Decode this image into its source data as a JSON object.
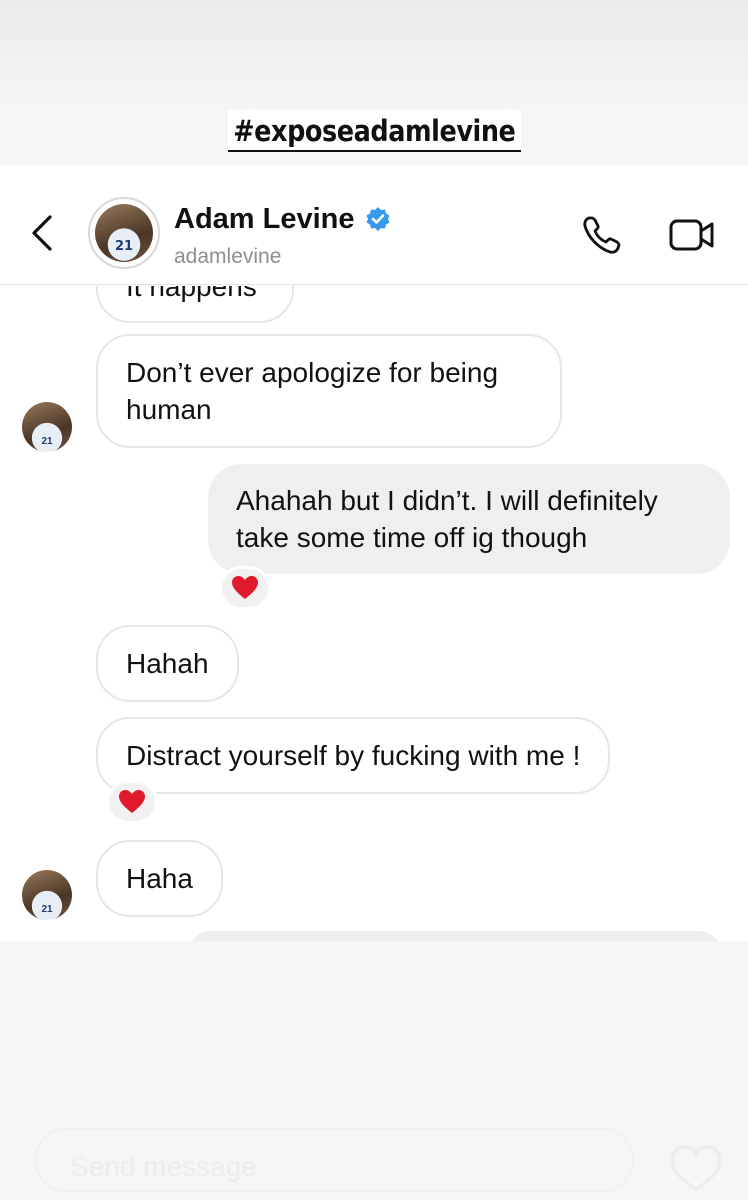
{
  "story": {
    "caption": "#exposeadamlevine",
    "composer_placeholder": "Send message"
  },
  "header": {
    "name": "Adam Levine",
    "handle": "adamlevine",
    "verified": true,
    "icons": [
      "back-chevron-icon",
      "verified-badge-icon",
      "phone-icon",
      "video-camera-icon"
    ]
  },
  "messages": [
    {
      "sender": "them",
      "text": "It happens",
      "partial": true
    },
    {
      "sender": "them",
      "text": "Don’t ever apologize for being human",
      "avatar": true
    },
    {
      "sender": "me",
      "text": "Ahahah but I didn’t. I will definitely take some time off ig though",
      "reaction": "heart"
    },
    {
      "sender": "them",
      "text": "Hahah"
    },
    {
      "sender": "them",
      "text": "Distract yourself by fucking with me !",
      "reaction": "heart"
    },
    {
      "sender": "them",
      "text": "Haha",
      "avatar": true
    }
  ],
  "colors": {
    "verified_blue": "#3897f0",
    "heart_red": "#e0192e",
    "outgoing_bubble": "#efefef",
    "incoming_border": "#e6e6e6"
  }
}
